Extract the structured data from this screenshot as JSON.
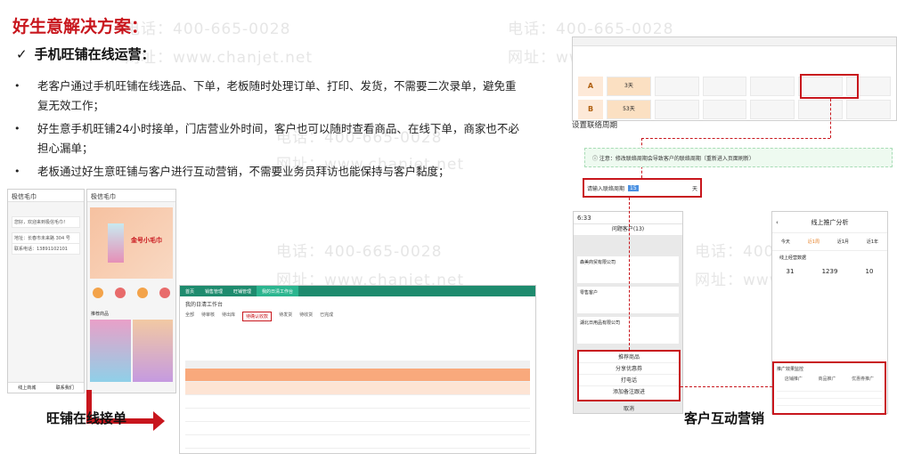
{
  "watermark": {
    "phone": "电话：400-665-0028",
    "web": "网址：www.chanjet.net"
  },
  "slide": {
    "title": "好生意解决方案：",
    "subtitle_check": "✓",
    "subtitle": "手机旺铺在线运营："
  },
  "bullets": [
    {
      "dot": "•",
      "text": "老客户通过手机旺铺在线选品、下单，老板随时处理订单、打印、发货，不需要二次录单，避免重复无效工作；"
    },
    {
      "dot": "•",
      "text": "好生意手机旺铺24小时接单，门店营业外时间，客户也可以随时查看商品、在线下单，商家也不必担心漏单；"
    },
    {
      "dot": "•",
      "text": "老板通过好生意旺铺与客户进行互动营销，不需要业务员拜访也能保持与客户黏度；"
    }
  ],
  "captions": {
    "left": "旺铺在线接单",
    "right": "客户互动营销"
  },
  "phone_left": {
    "title": "极信毛巾",
    "rows": [
      "您好，欢迎来到极信毛巾！",
      "地址：长春市未来路 304 号",
      "联系电话：13891102101"
    ],
    "footer_left": "线上商城",
    "footer_right": "联系我们"
  },
  "phone_mid": {
    "title": "极信毛巾",
    "banner": "金号小毛巾",
    "section": "推荐商品"
  },
  "desktop": {
    "tabs": [
      "首页",
      "销售管理",
      "旺铺管理",
      "我的日清工作台"
    ],
    "header": "我的日清工作台",
    "subtabs": [
      "全部",
      "待审核",
      "待出库",
      "待确认收款",
      "待发货",
      "待收货",
      "已完成"
    ]
  },
  "right_panel": {
    "row_labels": [
      "A",
      "B"
    ],
    "a_highlight": "3天",
    "b_highlight": "53天",
    "settings_title": "设置联络周期",
    "notice": "注意：修改联络周期会导致客户的联络周期（重新进入页面刷新）",
    "period_label": "请输入联络周期",
    "period_value": "15",
    "period_unit": "天"
  },
  "phone_customers": {
    "title": "问题客户(13)",
    "time": "6:33",
    "companies": [
      "森美商贸有限公司",
      "零售客户",
      "湖北日用品有限公司"
    ],
    "actions": [
      "推荐商品",
      "分享优惠券",
      "打电话",
      "添加备注跟进"
    ],
    "cancel": "取消"
  },
  "phone_analysis": {
    "title": "线上推广分析",
    "tabs": [
      "今天",
      "近1周",
      "近1月",
      "近1年"
    ],
    "summary_label": "线上经营数据",
    "stats": [
      "31",
      "1239",
      "10"
    ],
    "promo_title": "推广效果监控",
    "promo_cols": [
      "店铺推广",
      "商品推广",
      "优惠券推广"
    ]
  }
}
